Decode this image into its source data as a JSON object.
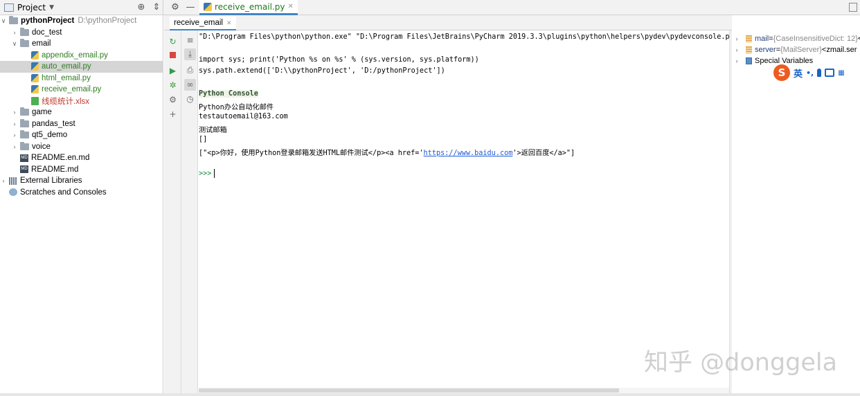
{
  "project_panel": {
    "title": "Project"
  },
  "editor_tab": {
    "label": "receive_email.py"
  },
  "tree": [
    {
      "label": "pythonProject",
      "path": "D:\\pythonProject"
    },
    {
      "label": "doc_test"
    },
    {
      "label": "email"
    },
    {
      "label": "appendix_email.py"
    },
    {
      "label": "auto_email.py"
    },
    {
      "label": "html_email.py"
    },
    {
      "label": "receive_email.py"
    },
    {
      "label": "线缆统计.xlsx"
    },
    {
      "label": "game"
    },
    {
      "label": "pandas_test"
    },
    {
      "label": "qt5_demo"
    },
    {
      "label": "voice"
    },
    {
      "label": "README.en.md"
    },
    {
      "label": "README.md"
    },
    {
      "label": "External Libraries"
    },
    {
      "label": "Scratches and Consoles"
    }
  ],
  "console_tab": {
    "label": "receive_email"
  },
  "console": {
    "lines": [
      "\"D:\\Program Files\\python\\python.exe\" \"D:\\Program Files\\JetBrains\\PyCharm 2019.3.3\\plugins\\python\\helpers\\pydev\\pydevconsole.py\" -",
      "import sys; print('Python %s on %s' % (sys.version, sys.platform))",
      "sys.path.extend(['D:\\\\pythonProject', 'D:/pythonProject'])",
      "Python Console",
      "Python办公自动化邮件",
      "testautoemail@163.com",
      "测试邮箱",
      "[]"
    ],
    "html_line": {
      "before": "[\"<p>你好，使用Python登录邮箱发送HTML邮件测试</p><a href='",
      "link": "https://www.baidu.com",
      "after": "'>返回百度</a>\"]"
    },
    "prompt": ">>>"
  },
  "variables": [
    {
      "name": "mail",
      "eq": " = ",
      "type": "{CaseInsensitiveDict: 12}",
      "value": " <"
    },
    {
      "name": "server",
      "eq": " = ",
      "type": "{MailServer}",
      "value": " <zmail.ser"
    },
    {
      "name": "Special Variables"
    }
  ],
  "ime": {
    "logo": "S",
    "lang": "英",
    "punct": "•,"
  },
  "watermark": "知乎 @donggela",
  "colors": {
    "accent": "#4083c9",
    "py_file": "#2f7d1f",
    "xlsx_file": "#c0392b",
    "link": "#1f5bd6"
  }
}
